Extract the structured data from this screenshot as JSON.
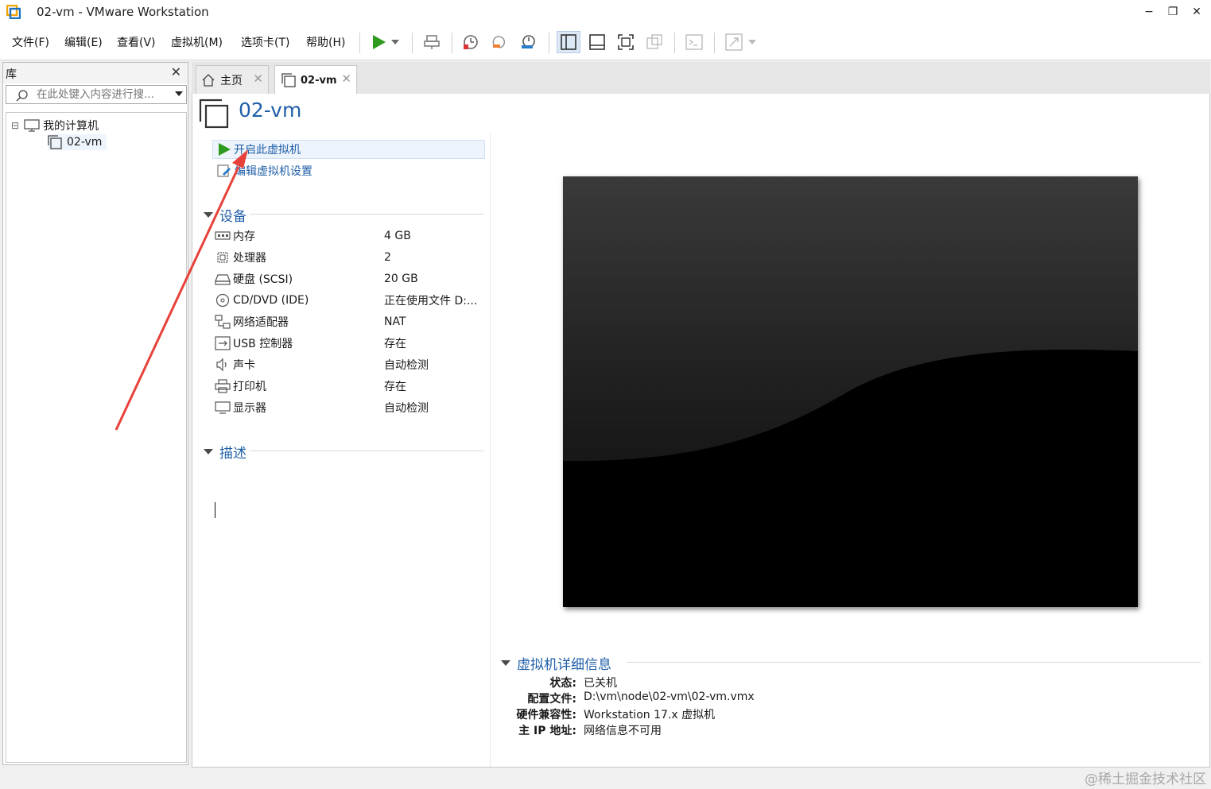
{
  "window": {
    "title": "02-vm - VMware Workstation",
    "minimize": "−",
    "restore": "❐",
    "close": "✕"
  },
  "menu": {
    "items": [
      "文件(F)",
      "编辑(E)",
      "查看(V)",
      "虚拟机(M)",
      "选项卡(T)",
      "帮助(H)"
    ]
  },
  "toolbar": {
    "icons": [
      "power-on-icon",
      "power-dropdown-icon",
      "send-keys-icon",
      "snapshot-take-icon",
      "snapshot-revert-icon",
      "snapshot-manager-icon",
      "library-view-icon",
      "thumbnail-view-icon",
      "fullscreen-icon",
      "unity-icon",
      "console-icon",
      "stretch-view-icon"
    ],
    "accent": "#2e9a1f"
  },
  "library": {
    "title": "库",
    "close": "✕",
    "search_placeholder": "在此处键入内容进行搜...",
    "tree": {
      "root_label": "我的计算机",
      "expander": "⊟",
      "child_label": "02-vm"
    }
  },
  "tabs": [
    {
      "label": "主页",
      "close": "✕"
    },
    {
      "label": "02-vm",
      "close": "✕"
    }
  ],
  "vm": {
    "name": "02-vm",
    "actions": [
      "开启此虚拟机",
      "编辑虚拟机设置"
    ],
    "devices_title": "设备",
    "devices": [
      {
        "name": "内存",
        "value": "4 GB",
        "icon": "memory-icon"
      },
      {
        "name": "处理器",
        "value": "2",
        "icon": "processor-icon"
      },
      {
        "name": "硬盘 (SCSI)",
        "value": "20 GB",
        "icon": "harddisk-icon"
      },
      {
        "name": "CD/DVD (IDE)",
        "value": "正在使用文件 D:...",
        "icon": "cd-dvd-icon"
      },
      {
        "name": "网络适配器",
        "value": "NAT",
        "icon": "network-adapter-icon"
      },
      {
        "name": "USB 控制器",
        "value": "存在",
        "icon": "usb-icon"
      },
      {
        "name": "声卡",
        "value": "自动检测",
        "icon": "sound-icon"
      },
      {
        "name": "打印机",
        "value": "存在",
        "icon": "printer-icon"
      },
      {
        "name": "显示器",
        "value": "自动检测",
        "icon": "display-icon"
      }
    ],
    "description_title": "描述",
    "details_title": "虚拟机详细信息",
    "details": [
      {
        "label": "状态:",
        "value": "已关机"
      },
      {
        "label": "配置文件:",
        "value": "D:\\vm\\node\\02-vm\\02-vm.vmx"
      },
      {
        "label": "硬件兼容性:",
        "value": "Workstation 17.x 虚拟机"
      },
      {
        "label": "主 IP 地址:",
        "value": "网络信息不可用"
      }
    ]
  },
  "annotation": {
    "arrow_color": "#e8413a"
  },
  "watermark": "@稀土掘金技术社区"
}
